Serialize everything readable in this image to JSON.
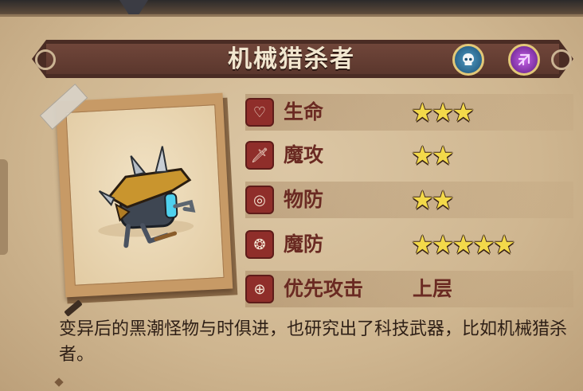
{
  "title": "机械猎杀者",
  "badges": [
    {
      "icon": "skull-icon",
      "color": "#2f6f99"
    },
    {
      "icon": "magic-rune-icon",
      "color": "#8a34b5"
    }
  ],
  "stats": [
    {
      "label": "生命",
      "icon": "heart-icon",
      "stars": 3,
      "stars_text": "★★★"
    },
    {
      "label": "魔攻",
      "icon": "sword-icon",
      "stars": 2,
      "stars_text": "★★"
    },
    {
      "label": "物防",
      "icon": "shield-icon",
      "stars": 2,
      "stars_text": "★★"
    },
    {
      "label": "魔防",
      "icon": "magic-shield-icon",
      "stars": 5,
      "stars_text": "★★★★★"
    }
  ],
  "priority": {
    "label": "优先攻击",
    "icon": "target-icon",
    "value": "上层"
  },
  "description": "变异后的黑潮怪物与时俱进，也研究出了科技武器，比如机械猎杀者。",
  "colors": {
    "banner": "#5b372d",
    "star": "#f3d94a",
    "stat_icon_bg": "#8f2e2a",
    "label": "#6a2a22"
  }
}
